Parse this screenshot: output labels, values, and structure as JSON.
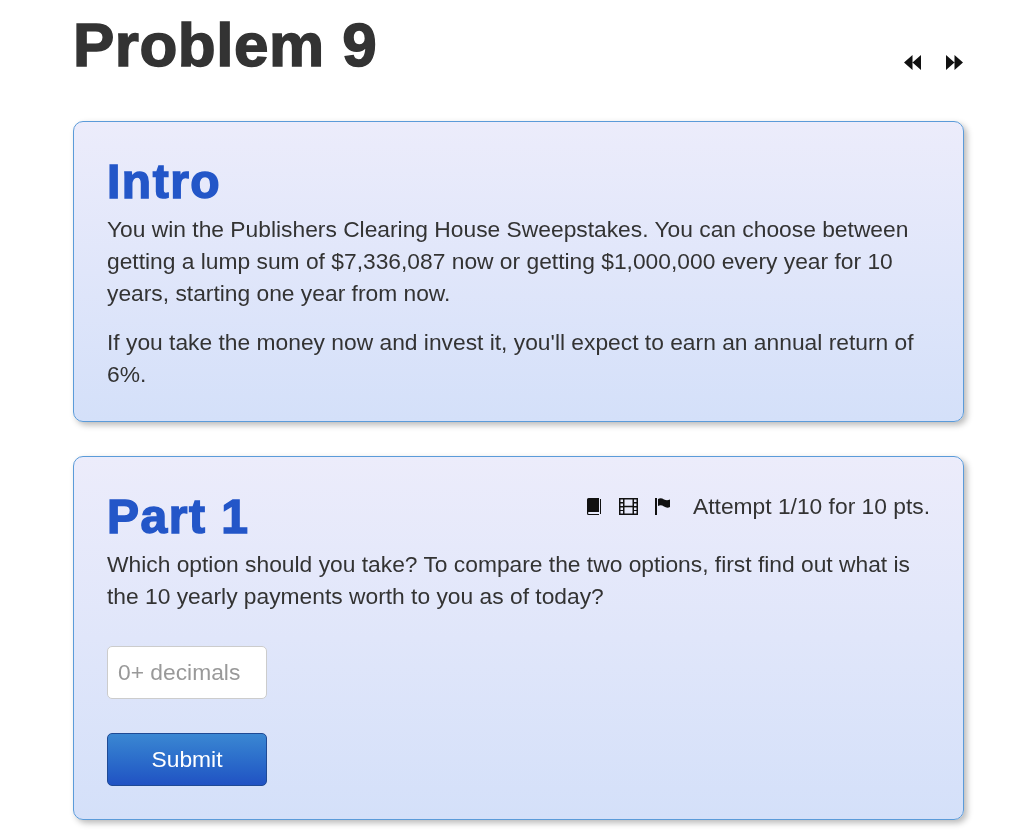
{
  "header": {
    "title": "Problem 9"
  },
  "intro": {
    "heading": "Intro",
    "paragraphs": [
      "You win the Publishers Clearing House Sweepstakes. You can choose between getting a lump sum of $7,336,087 now or getting $1,000,000 every year for 10 years, starting one year from now.",
      "If you take the money now and invest it, you'll expect to earn an annual return of 6%."
    ]
  },
  "parts": [
    {
      "heading": "Part 1",
      "attempt": "Attempt 1/10 for 10 pts.",
      "question": "Which option should you take? To compare the two options, first find out what is the 10 yearly payments worth to you as of today?",
      "answer": {
        "placeholder": "0+ decimals"
      },
      "submit": "Submit"
    }
  ]
}
